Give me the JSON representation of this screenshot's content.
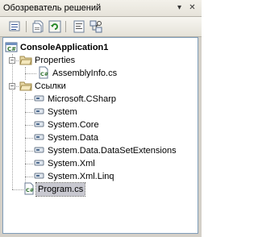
{
  "window": {
    "title": "Обозреватель решений",
    "pin_glyph": "▾",
    "close_glyph": "✕"
  },
  "toolbar": {
    "icons": [
      "properties-icon",
      "show-all-files-icon",
      "refresh-icon",
      "view-code-icon",
      "class-diagram-icon"
    ]
  },
  "tree": {
    "solution": {
      "label": "ConsoleApplication1",
      "icon": "csharp-project-icon"
    },
    "properties": {
      "label": "Properties",
      "icon": "folder-icon",
      "expanded": true
    },
    "assemblyinfo": {
      "label": "AssemblyInfo.cs",
      "icon": "csharp-file-icon"
    },
    "references": {
      "label": "Ссылки",
      "icon": "folder-icon",
      "expanded": true
    },
    "reference_items": [
      "Microsoft.CSharp",
      "System",
      "System.Core",
      "System.Data",
      "System.Data.DataSetExtensions",
      "System.Xml",
      "System.Xml.Linq"
    ],
    "program": {
      "label": "Program.cs",
      "icon": "csharp-file-icon",
      "selected": true
    }
  },
  "colors": {
    "panel_bg": "#d4d0c8",
    "tree_border": "#7f9db9",
    "selection": "#c8c8d0"
  }
}
